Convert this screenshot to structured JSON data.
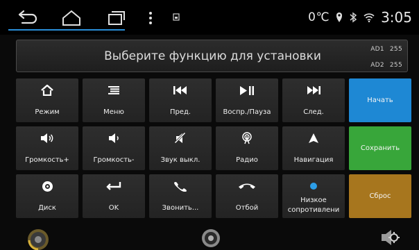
{
  "status_bar": {
    "temperature": "0℃",
    "time": "3:05",
    "accent": "#2a8fd9"
  },
  "panel": {
    "message": "Выберите функцию для установки",
    "ad1_label": "AD1",
    "ad1_value": "255",
    "ad2_label": "AD2",
    "ad2_value": "255"
  },
  "keys": [
    {
      "label": "Режим",
      "icon": "home-icon"
    },
    {
      "label": "Меню",
      "icon": "menu-icon"
    },
    {
      "label": "Пред.",
      "icon": "skip-previous-icon"
    },
    {
      "label": "Воспр./Пауза",
      "icon": "play-pause-icon"
    },
    {
      "label": "След.",
      "icon": "skip-next-icon"
    },
    {
      "label": "Громкость+",
      "icon": "volume-up-icon"
    },
    {
      "label": "Громкость-",
      "icon": "volume-down-icon"
    },
    {
      "label": "Звук выкл.",
      "icon": "mute-icon"
    },
    {
      "label": "Радио",
      "icon": "radio-icon"
    },
    {
      "label": "Навигация",
      "icon": "navigation-icon"
    },
    {
      "label": "Диск",
      "icon": "disc-icon"
    },
    {
      "label": "OK",
      "icon": "enter-icon"
    },
    {
      "label": "Звонить...",
      "icon": "phone-call-icon"
    },
    {
      "label": "Отбой",
      "icon": "hang-up-icon"
    },
    {
      "label": "Низкое сопротивлени",
      "icon": "status-dot-icon"
    }
  ],
  "actions": {
    "start_label": "Начать",
    "save_label": "Сохранить",
    "reset_label": "Сброс",
    "start_color": "#1e88d4",
    "save_color": "#38a63a",
    "reset_color": "#a7761e"
  }
}
